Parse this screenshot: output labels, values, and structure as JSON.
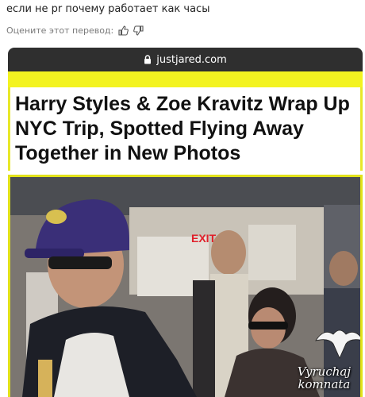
{
  "post": {
    "text": "если не pr почему работает как часы"
  },
  "translation": {
    "rate_label": "Оцените этот перевод:",
    "like_icon": "thumbs-up-icon",
    "dislike_icon": "thumbs-down-icon"
  },
  "browser": {
    "url": "justjared.com",
    "lock_icon": "lock-icon"
  },
  "article": {
    "headline": "Harry Styles & Zoe Kravitz Wrap Up NYC Trip, Spotted Flying Away Together in New Photos"
  },
  "photo": {
    "exit_sign": "EXIT"
  },
  "watermark": {
    "line1": "Vyruchaj",
    "line2": "komnata"
  },
  "colors": {
    "highlight": "#f3f320",
    "urlbar": "#2f2f2f"
  }
}
